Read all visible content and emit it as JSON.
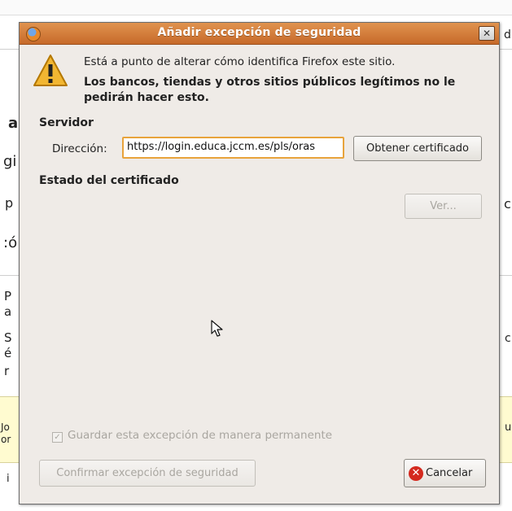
{
  "background": {
    "fragments": {
      "a": "a",
      "gi": "gi",
      "p": "p",
      "co": ":ó",
      "p2": "P",
      "a2": "a",
      "s": "S",
      "e": "é",
      "r": "r",
      "jo": "Jo",
      "or": "or",
      "i": "i",
      "d": "d",
      "c": "c",
      "c2": "c",
      "u": "u"
    }
  },
  "dialog": {
    "title": "Añadir excepción de seguridad",
    "close_label": "✕",
    "message": "Está a punto de alterar cómo identifica Firefox este sitio.",
    "warning": "Los bancos, tiendas y otros sitios públicos legítimos no le pedirán hacer esto.",
    "server_section": "Servidor",
    "address_label": "Dirección:",
    "address_value": "https://login.educa.jccm.es/pls/oras",
    "get_cert_button": "Obtener certificado",
    "cert_status_section": "Estado del certificado",
    "view_button": "Ver...",
    "permanent_checkbox": {
      "label": "Guardar esta excepción de manera permanente",
      "checked": true,
      "enabled": false
    },
    "confirm_button": "Confirmar excepción de seguridad",
    "cancel_button": "Cancelar"
  },
  "colors": {
    "titlebar": "#d07a38",
    "dialog_bg": "#efebe7",
    "input_focus": "#e8a33c",
    "cancel_icon": "#d42a1f"
  }
}
